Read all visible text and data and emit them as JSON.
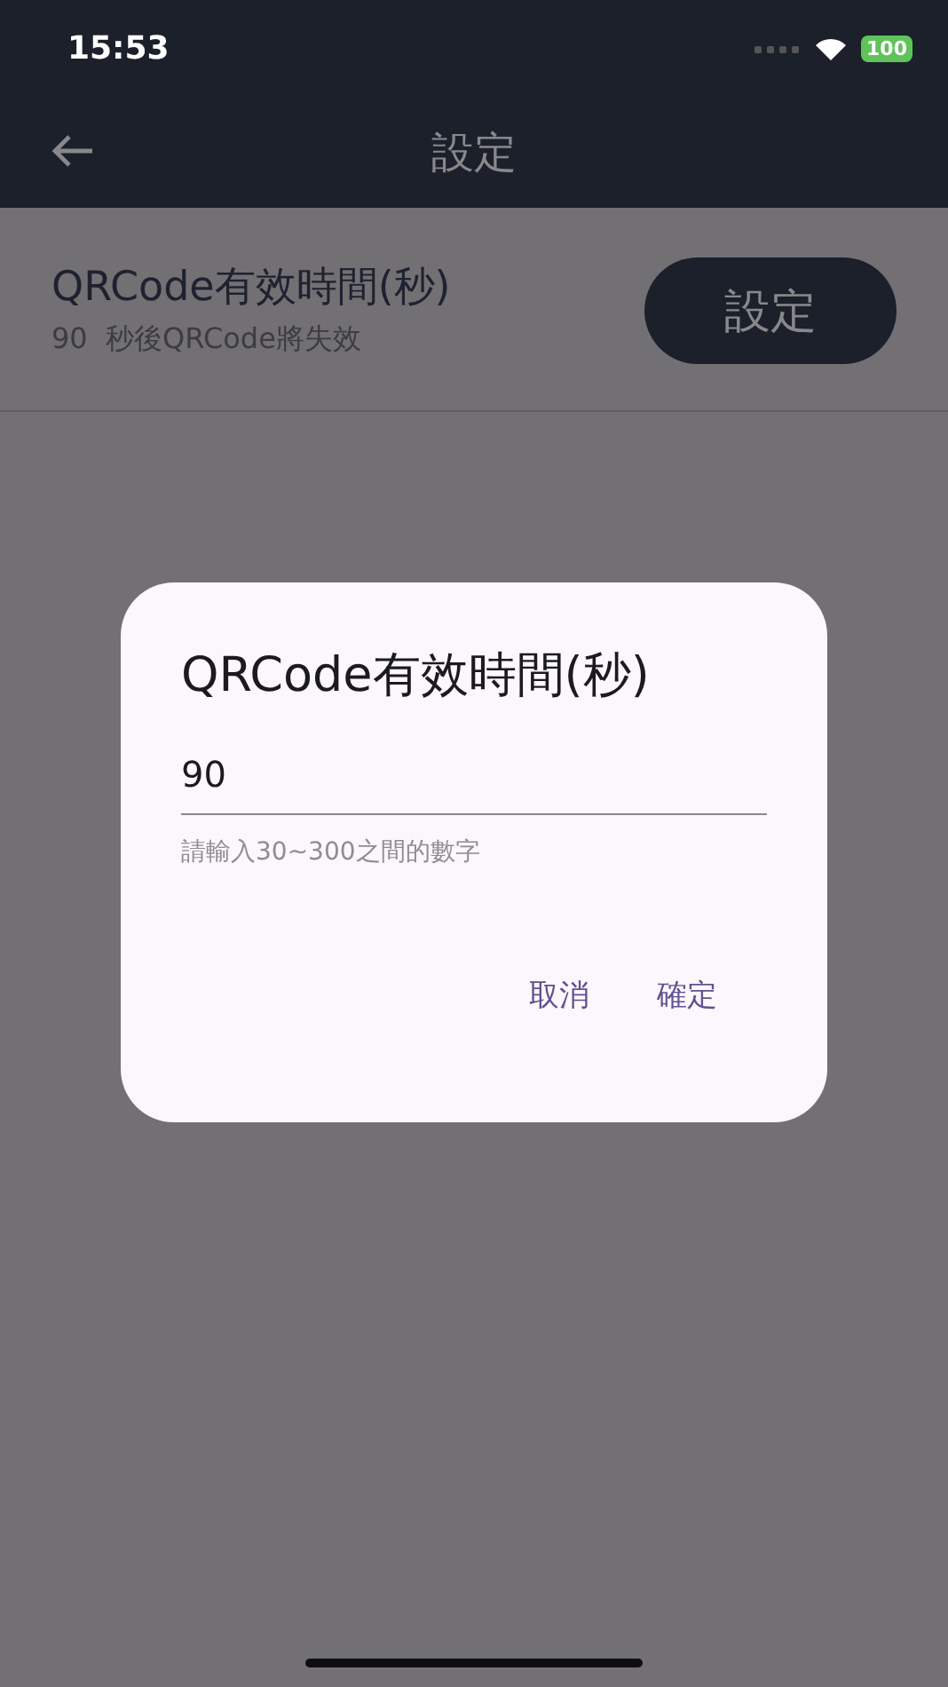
{
  "status_bar": {
    "time": "15:53",
    "battery": "100"
  },
  "header": {
    "title": "設定"
  },
  "settings": [
    {
      "title": "QRCode有效時間(秒)",
      "subtitle": "90  秒後QRCode將失效",
      "button": "設定"
    }
  ],
  "dialog": {
    "title": "QRCode有效時間(秒)",
    "value": "90",
    "helper": "請輸入30~300之間的數字",
    "buttons": [
      "取消",
      "確定"
    ]
  }
}
